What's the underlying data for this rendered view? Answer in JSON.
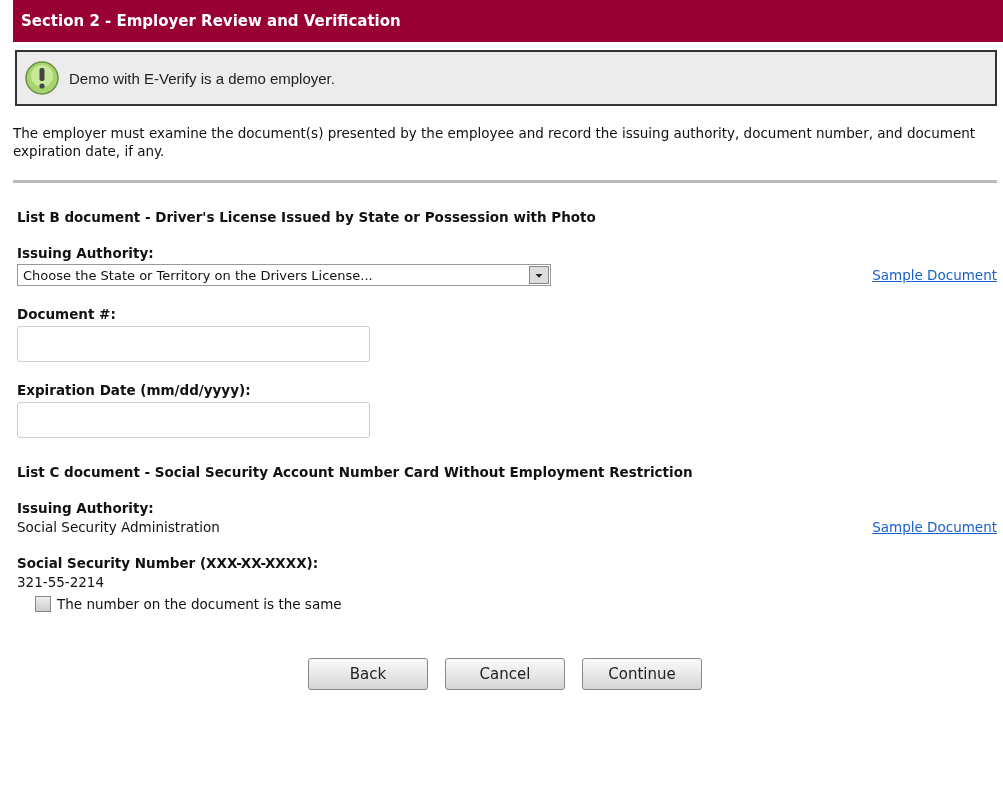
{
  "header": {
    "title": "Section 2 - Employer Review and Verification"
  },
  "notice": {
    "text": "Demo with E-Verify is a demo employer."
  },
  "instructions": "The employer must examine the document(s) presented by the employee and record the issuing authority, document number, and document expiration date, if any.",
  "sections": [
    {
      "heading": "List B document - Driver's License Issued by State or Possession with Photo",
      "fields": [
        {
          "kind": "select",
          "label": "Issuing Authority:",
          "value": "Choose the State or Territory on the Drivers License...",
          "link": "Sample Document"
        },
        {
          "kind": "input",
          "label": "Document #:"
        },
        {
          "kind": "input",
          "label": "Expiration Date (mm/dd/yyyy):"
        }
      ]
    },
    {
      "heading": "List C document - Social Security Account Number Card Without Employment Restriction",
      "fields": [
        {
          "kind": "static",
          "label": "Issuing Authority:",
          "value": "Social Security Administration",
          "link": "Sample Document"
        },
        {
          "kind": "static",
          "label": "Social Security Number (XXX-XX-XXXX):",
          "value": "321-55-2214"
        }
      ],
      "checkbox": {
        "label": "The number on the document is the same",
        "checked": false
      }
    }
  ],
  "buttons": [
    "Back",
    "Cancel",
    "Continue"
  ]
}
